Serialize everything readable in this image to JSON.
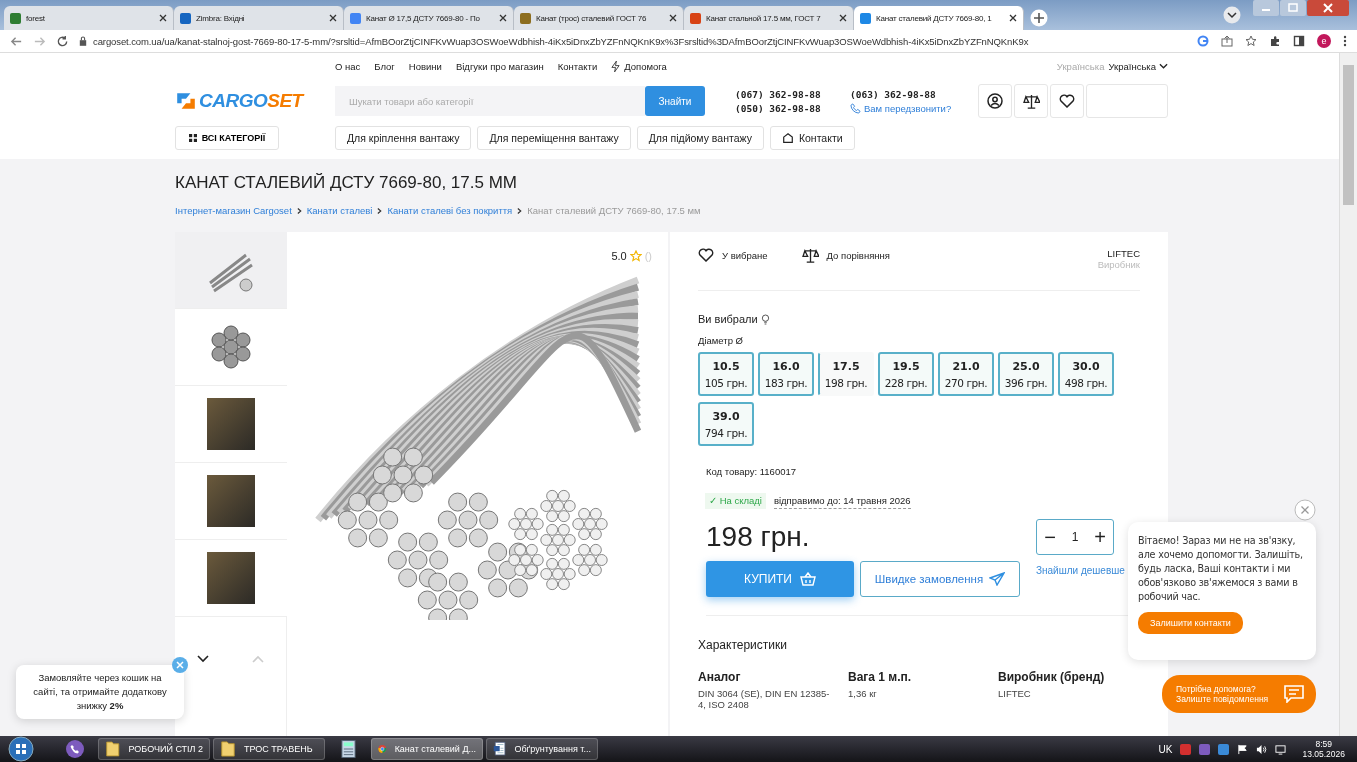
{
  "browser": {
    "tabs": [
      {
        "title": "forest",
        "color": "#2e7d32",
        "selected": false
      },
      {
        "title": "Zimbra: Вхідні",
        "color": "#1565c0",
        "selected": false
      },
      {
        "title": "Канат Ø 17,5 ДСТУ 7669-80 - По",
        "color": "#4285f4",
        "selected": false
      },
      {
        "title": "Канат (трос) сталевий ГОСТ 76",
        "color": "#8d6e1f",
        "selected": false
      },
      {
        "title": "Канат стальной 17.5 мм, ГОСТ 7",
        "color": "#d84315",
        "selected": false
      },
      {
        "title": "Канат сталевий ДСТУ 7669-80, 1",
        "color": "#1e88e5",
        "selected": true
      }
    ],
    "url": "cargoset.com.ua/ua/kanat-stalnoj-gost-7669-80-17-5-mm/?srsltid=AfmBOorZtjCINFKvWuap3OSWoeWdbhish-4iKx5iDnxZbYZFnNQKnK9x%3Fsrsltid%3DAfmBOorZtjCINFKvWuap3OSWoeWdbhish-4iKx5iDnxZbYZFnNQKnK9x",
    "profile": "e"
  },
  "header": {
    "top_links": [
      "О нас",
      "Блог",
      "Новини",
      "Відгуки про магазин",
      "Контакти"
    ],
    "help_link": "Допомога",
    "language": {
      "inactive": "Українська",
      "current": "Українська"
    },
    "logo": {
      "part_1": "CARGO",
      "part_2": "SET"
    },
    "search": {
      "placeholder": "Шукати товари або категорії",
      "button": "Знайти"
    },
    "phones": [
      "(067) 362-98-88",
      "(050) 362-98-88",
      "(063) 362-98-88"
    ],
    "callback": "Вам передзвонити?",
    "catalog_button": "ВСІ КАТЕГОРІЇ",
    "nav": [
      "Для кріплення вантажу",
      "Для переміщення вантажу",
      "Для підйому вантажу"
    ],
    "nav_contacts": "Контакти"
  },
  "page": {
    "title": "КАНАТ СТАЛЕВИЙ ДСТУ 7669-80, 17.5 ММ",
    "breadcrumbs": [
      {
        "label": "Інтернет-магазин Cargoset",
        "current": false
      },
      {
        "label": "Канати сталеві",
        "current": false
      },
      {
        "label": "Канати сталеві без покриття",
        "current": false
      },
      {
        "label": "Канат сталевий ДСТУ 7669-80, 17.5 мм",
        "current": true
      }
    ]
  },
  "gallery": {
    "thumbnails": [
      {
        "kind": "rope",
        "selected": true
      },
      {
        "kind": "section",
        "selected": false
      },
      {
        "kind": "photo",
        "selected": false
      },
      {
        "kind": "photo",
        "selected": false
      },
      {
        "kind": "photo",
        "selected": false
      }
    ]
  },
  "rating": {
    "score": "5.0",
    "count": "()"
  },
  "product": {
    "favorite": "У вибране",
    "compare": "До порівняння",
    "brand": "LIFTEC",
    "brand_label": "Виробник",
    "chosen_label": "Ви вибрали",
    "option_label": "Діаметр Ø",
    "variants": [
      {
        "size": "10.5",
        "price": "105 грн.",
        "selected": false
      },
      {
        "size": "16.0",
        "price": "183 грн.",
        "selected": false
      },
      {
        "size": "17.5",
        "price": "198 грн.",
        "selected": true
      },
      {
        "size": "19.5",
        "price": "228 грн.",
        "selected": false
      },
      {
        "size": "21.0",
        "price": "270 грн.",
        "selected": false
      },
      {
        "size": "25.0",
        "price": "396 грн.",
        "selected": false
      },
      {
        "size": "30.0",
        "price": "498 грн.",
        "selected": false
      },
      {
        "size": "39.0",
        "price": "794 грн.",
        "selected": false
      }
    ],
    "code": "Код товару: 1160017",
    "stock": "✓ На складі",
    "shipping": "відправимо до: 14 травня 2026",
    "price": "198 грн.",
    "quantity": {
      "minus": "−",
      "value": "1",
      "plus": "+"
    },
    "buy_button": "КУПИТИ",
    "quick_order": "Швидке замовлення",
    "cheaper_link": "Знайшли дешевше"
  },
  "characteristics": {
    "title": "Характеристики",
    "items": [
      {
        "name": "Аналог",
        "value": "DIN 3064 (SE), DIN EN 12385-4, ISO 2408"
      },
      {
        "name": "Вага 1 м.п.",
        "value": "1,36 кг"
      },
      {
        "name": "Виробник (бренд)",
        "value": "LIFTEC"
      }
    ]
  },
  "promo": {
    "text": "Замовляйте через кошик на сайті, та отримайте додаткову знижку **2%**"
  },
  "chat": {
    "message": "Вітаємо! Зараз ми не на зв'язку, але хочемо допомогти. Залишіть, будь ласка, Ваші контакти і ми обов'язково зв'яжемося з вами в робочий час.",
    "button": "Залишити контакти",
    "help_title": "Потрібна допомога?",
    "help_subtitle": "Залиште повідомлення"
  },
  "taskbar": {
    "items": [
      {
        "kind": "viber",
        "selected": false
      },
      {
        "kind": "folder",
        "label": "РОБОЧИЙ СТІЛ 2",
        "selected": false
      },
      {
        "kind": "folder",
        "label": "ТРОС ТРАВЕНЬ",
        "selected": false
      },
      {
        "kind": "calculator",
        "selected": false
      },
      {
        "kind": "browser",
        "label": "Канат сталевий Д...",
        "selected": true
      },
      {
        "kind": "document",
        "label": "Обґрунтування т...",
        "selected": false
      }
    ],
    "language": "UK",
    "time": "8:59",
    "date": "13.05.2026"
  }
}
